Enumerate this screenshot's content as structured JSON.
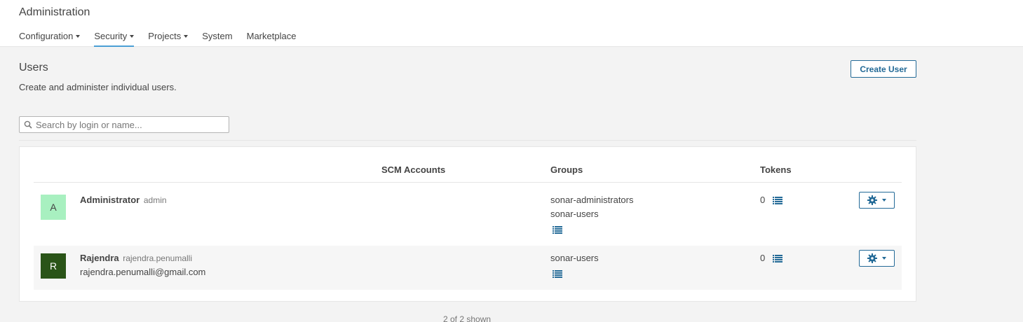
{
  "header": {
    "title": "Administration",
    "nav": [
      {
        "label": "Configuration",
        "has_caret": true
      },
      {
        "label": "Security",
        "has_caret": true,
        "active": true
      },
      {
        "label": "Projects",
        "has_caret": true
      },
      {
        "label": "System",
        "has_caret": false
      },
      {
        "label": "Marketplace",
        "has_caret": false
      }
    ]
  },
  "page": {
    "title": "Users",
    "description": "Create and administer individual users.",
    "create_button_label": "Create User",
    "search": {
      "placeholder": "Search by login or name...",
      "value": ""
    }
  },
  "table": {
    "columns": [
      "",
      "SCM Accounts",
      "Groups",
      "Tokens"
    ],
    "rows": [
      {
        "avatar_letter": "A",
        "avatar_bg": "#a8f0c0",
        "avatar_fg": "#444444",
        "name": "Administrator",
        "login": "admin",
        "email": "",
        "groups": [
          "sonar-administrators",
          "sonar-users"
        ],
        "tokens": "0",
        "icons": {
          "groups": "list-icon",
          "tokens": "list-icon",
          "actions": "gear-icon"
        }
      },
      {
        "avatar_letter": "R",
        "avatar_bg": "#2a5418",
        "avatar_fg": "#ffffff",
        "name": "Rajendra",
        "login": "rajendra.penumalli",
        "email": "rajendra.penumalli@gmail.com",
        "groups": [
          "sonar-users"
        ],
        "tokens": "0",
        "icons": {
          "groups": "list-icon",
          "tokens": "list-icon",
          "actions": "gear-icon"
        }
      }
    ]
  },
  "footer": {
    "count_text": "2 of 2 shown"
  },
  "colors": {
    "accent": "#236a97",
    "active_tab": "#4b9fd5",
    "background": "#f3f3f3"
  }
}
